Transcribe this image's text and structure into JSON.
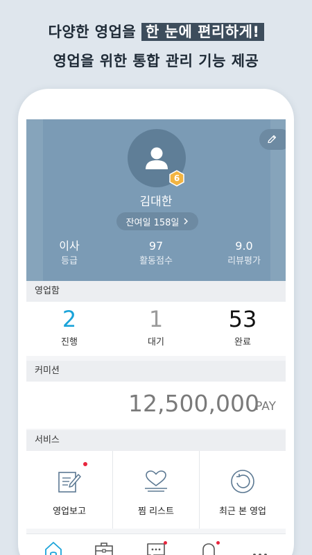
{
  "promo": {
    "line1_prefix": "다양한 영업을",
    "line1_highlight": "한 눈에 편리하게!",
    "line2": "영업을 위한 통합 관리 기능 제공"
  },
  "profile": {
    "name": "김대한",
    "level_badge": "6",
    "remaining_days": "잔여일 158일",
    "stats": [
      {
        "value": "이사",
        "label": "등급"
      },
      {
        "value": "97",
        "label": "활동점수"
      },
      {
        "value": "9.0",
        "label": "리뷰평가"
      }
    ]
  },
  "sales_box": {
    "title": "영업함",
    "items": [
      {
        "value": "2",
        "label": "진행",
        "color": "#1aa3d9"
      },
      {
        "value": "1",
        "label": "대기",
        "color": "#9a9a9a"
      },
      {
        "value": "53",
        "label": "완료",
        "color": "#111111"
      }
    ]
  },
  "commission": {
    "title": "커미션",
    "amount": "12,500,000",
    "unit": "PAY"
  },
  "services": {
    "title": "서비스",
    "items": [
      {
        "label": "영업보고",
        "icon": "report-pen-icon",
        "has_new": true
      },
      {
        "label": "찜 리스트",
        "icon": "heart-list-icon",
        "has_new": false
      },
      {
        "label": "최근 본 영업",
        "icon": "history-icon",
        "has_new": false
      }
    ]
  },
  "tabbar": {
    "items": [
      {
        "icon": "home-icon",
        "active": true,
        "has_new": false
      },
      {
        "icon": "briefcase-icon",
        "active": false,
        "has_new": false
      },
      {
        "icon": "chat-icon",
        "active": false,
        "has_new": true
      },
      {
        "icon": "bell-icon",
        "active": false,
        "has_new": true
      },
      {
        "icon": "more-icon",
        "active": false,
        "has_new": false
      }
    ]
  },
  "colors": {
    "profile_bg": "#7b9bb5",
    "accent_blue": "#1aa3d9",
    "notification_red": "#e8253d",
    "page_bg": "#dfe6ed"
  }
}
